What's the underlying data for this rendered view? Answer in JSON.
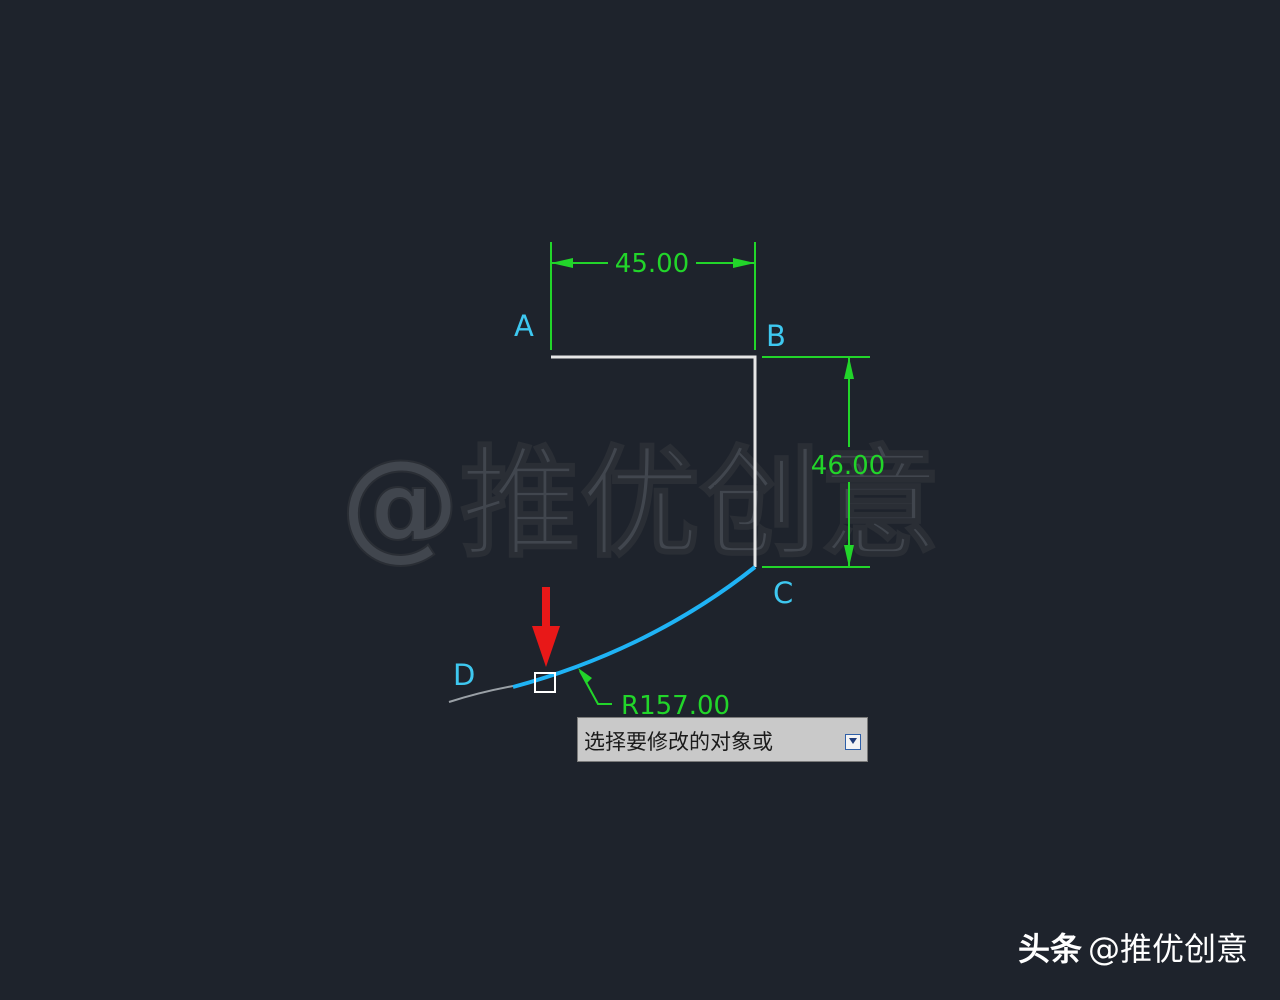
{
  "drawing": {
    "point_labels": {
      "a": "A",
      "b": "B",
      "c": "C",
      "d": "D"
    },
    "dimension_horizontal": "45.00",
    "dimension_vertical": "46.00",
    "dimension_radius": "R157.00",
    "watermark": "@推优创意",
    "colors": {
      "background": "#1e232c",
      "geometry_line": "#e6e6e6",
      "dimension": "#22d52a",
      "point_label": "#3ec8f0",
      "selected_arc": "#1fb3f5",
      "arrow_marker": "#e81818"
    }
  },
  "tooltip": {
    "prompt_text": "选择要修改的对象或",
    "option_icon": "dropdown-arrow-icon"
  },
  "footer": {
    "brand": "头条",
    "handle": "@推优创意"
  }
}
